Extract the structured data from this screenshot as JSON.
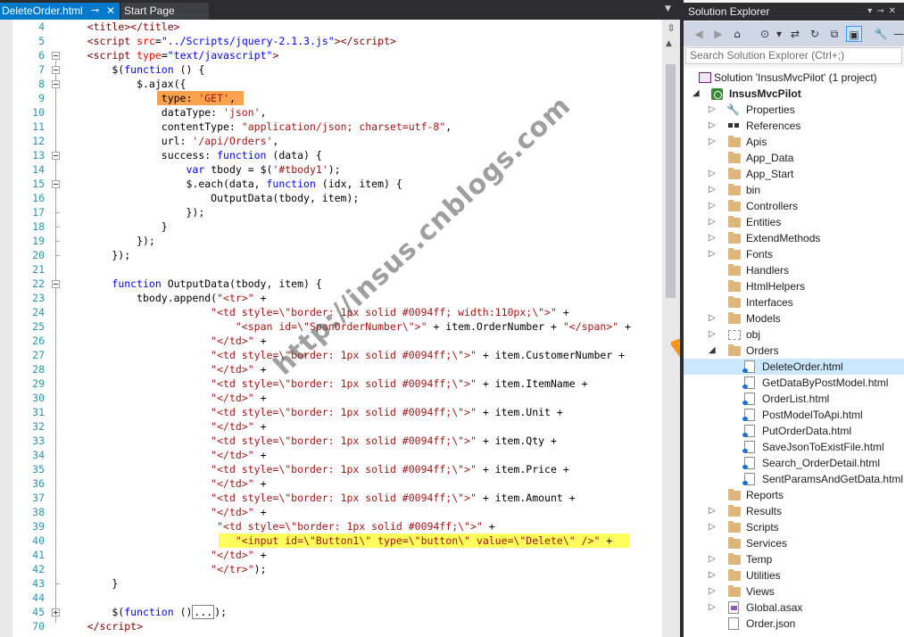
{
  "editor": {
    "tabs": [
      {
        "label": "DeleteOrder.html",
        "active": true
      },
      {
        "label": "Start Page",
        "active": false
      }
    ],
    "pin_icon": "pin-icon",
    "close_icon": "close-icon",
    "line_numbers": [
      "4",
      "5",
      "6",
      "7",
      "8",
      "9",
      "10",
      "11",
      "12",
      "13",
      "14",
      "15",
      "16",
      "17",
      "18",
      "19",
      "20",
      "21",
      "22",
      "23",
      "24",
      "25",
      "26",
      "27",
      "28",
      "29",
      "30",
      "31",
      "32",
      "33",
      "34",
      "35",
      "36",
      "37",
      "38",
      "39",
      "40",
      "41",
      "42",
      "43",
      "44",
      "45",
      "70"
    ],
    "colors": {
      "keyword": "#0000ff",
      "tag": "#800000",
      "attribute": "#ff0000",
      "string": "#a31515",
      "highlight_orange": "#f9a24d",
      "highlight_yellow": "#ffff5c"
    }
  },
  "watermark": "http://insus.cnblogs.com",
  "solution_explorer": {
    "title": "Solution Explorer",
    "search_placeholder": "Search Solution Explorer (Ctrl+;)",
    "solution_label": "Solution 'InsusMvcPilot' (1 project)",
    "project_label": "InsusMvcPilot",
    "items": [
      {
        "label": "Properties"
      },
      {
        "label": "References"
      },
      {
        "label": "Apis"
      },
      {
        "label": "App_Data"
      },
      {
        "label": "App_Start"
      },
      {
        "label": "bin"
      },
      {
        "label": "Controllers"
      },
      {
        "label": "Entities"
      },
      {
        "label": "ExtendMethods"
      },
      {
        "label": "Fonts"
      },
      {
        "label": "Handlers"
      },
      {
        "label": "HtmlHelpers"
      },
      {
        "label": "Interfaces"
      },
      {
        "label": "Models"
      },
      {
        "label": "obj"
      },
      {
        "label": "Orders"
      },
      {
        "label": "DeleteOrder.html"
      },
      {
        "label": "GetDataByPostModel.html"
      },
      {
        "label": "OrderList.html"
      },
      {
        "label": "PostModelToApi.html"
      },
      {
        "label": "PutOrderData.html"
      },
      {
        "label": "SaveJsonToExistFile.html"
      },
      {
        "label": "Search_OrderDetail.html"
      },
      {
        "label": "SentParamsAndGetData.html"
      },
      {
        "label": "Reports"
      },
      {
        "label": "Results"
      },
      {
        "label": "Scripts"
      },
      {
        "label": "Services"
      },
      {
        "label": "Temp"
      },
      {
        "label": "Utilities"
      },
      {
        "label": "Views"
      },
      {
        "label": "Global.asax"
      },
      {
        "label": "Order.json"
      }
    ]
  }
}
